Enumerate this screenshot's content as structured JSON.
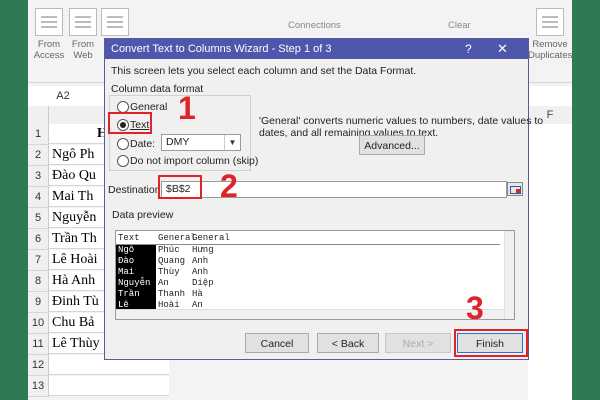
{
  "ribbon": {
    "from_access": "From Access",
    "from_web": "From Web",
    "connections": "Connections",
    "clear": "Clear",
    "remove_duplicates": "Remove Duplicates"
  },
  "name_box": "A2",
  "columns": [
    "A",
    "F"
  ],
  "rows": [
    "1",
    "2",
    "3",
    "4",
    "5",
    "6",
    "7",
    "8",
    "9",
    "10",
    "11",
    "12",
    "13"
  ],
  "cells": [
    "Họ",
    "Ngô Ph",
    "Đào Qu",
    "Mai Th",
    "Nguyễn",
    "Trần Th",
    "Lê Hoài",
    "Hà Anh",
    "Đinh Tù",
    "Chu Bả",
    "Lê Thùy",
    "",
    ""
  ],
  "dialog": {
    "title": "Convert Text to Columns Wizard - Step 1 of 3",
    "help": "?",
    "close": "✕",
    "intro": "This screen lets you select each column and set the Data Format.",
    "format_group": "Column data format",
    "options": [
      "General",
      "Text",
      "Date:",
      "Do not import column (skip)"
    ],
    "date_value": "DMY",
    "description_line1": "'General' converts numeric values to numbers, date values to",
    "description_line2": "dates, and all remaining values to text.",
    "advanced": "Advanced...",
    "destination_label": "Destination:",
    "destination_value": "$B$2",
    "preview_label": "Data preview",
    "preview_headers": [
      "Text",
      "General",
      "General"
    ],
    "preview_rows": [
      [
        "Ngô",
        "Phúc",
        "Hưng"
      ],
      [
        "Đào",
        "Quang",
        "Anh"
      ],
      [
        "Mai",
        "Thùy",
        "Anh"
      ],
      [
        "Nguyễn",
        "An",
        "Diệp"
      ],
      [
        "Trần",
        "Thanh",
        "Hà"
      ],
      [
        "Lê",
        "Hoài",
        "An"
      ]
    ],
    "buttons": [
      "Cancel",
      "< Back",
      "Next >",
      "Finish"
    ]
  },
  "step_labels": [
    "1",
    "2",
    "3"
  ],
  "colors": {
    "annotation": "#e0232a",
    "titlebar": "#4f57ad",
    "background": "#2f7a52"
  }
}
